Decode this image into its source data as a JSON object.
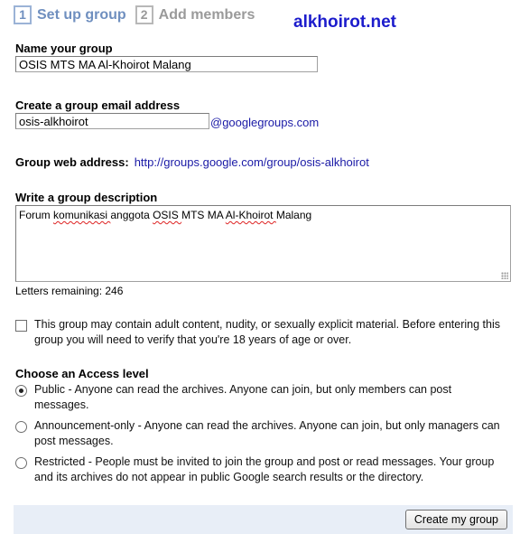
{
  "steps": [
    {
      "num": "1",
      "label": "Set up group"
    },
    {
      "num": "2",
      "label": "Add members"
    }
  ],
  "watermark": "alkhoirot.net",
  "name": {
    "label": "Name your group",
    "value": "OSIS MTS MA Al-Khoirot Malang"
  },
  "email": {
    "label": "Create a group email address",
    "value": "osis-alkhoirot",
    "domain": "@googlegroups.com"
  },
  "web": {
    "label": "Group web address:",
    "url": "http://groups.google.com/group/osis-alkhoirot"
  },
  "description": {
    "label": "Write a group description",
    "words": [
      "Forum",
      "komunikasi",
      "anggota",
      "OSIS",
      "MTS",
      "MA",
      "Al-Khoirot",
      "Malang"
    ],
    "letters_remaining": "Letters remaining: 246"
  },
  "adult": {
    "checked": false,
    "text": "This group may contain adult content, nudity, or sexually explicit material. Before entering this group you will need to verify that you're 18 years of age or over."
  },
  "access": {
    "label": "Choose an Access level",
    "options": [
      {
        "text": "Public - Anyone can read the archives. Anyone can join, but only members can post messages.",
        "checked": true
      },
      {
        "text": "Announcement-only - Anyone can read the archives. Anyone can join, but only managers can post messages.",
        "checked": false
      },
      {
        "text": "Restricted - People must be invited to join the group and post or read messages. Your group and its archives do not appear in public Google search results or the directory.",
        "checked": false
      }
    ]
  },
  "create_button": "Create my group"
}
